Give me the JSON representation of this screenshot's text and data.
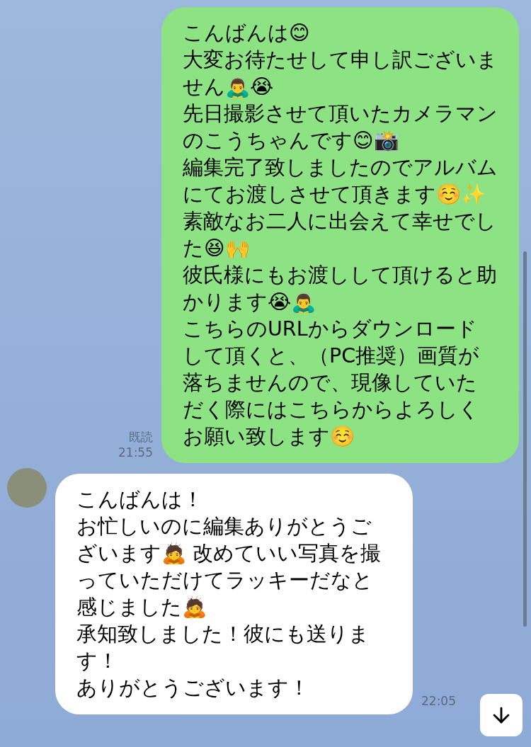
{
  "messages": [
    {
      "kind": "sent",
      "paragraphs": [
        "こんばんは😊",
        "大変お待たせして申し訳ございません🙇‍♂️😭",
        "先日撮影させて頂いたカメラマンのこうちゃんです😊📸",
        "編集完了致しましたのでアルバムにてお渡しさせて頂きます☺️✨",
        "素敵なお二人に出会えて幸せでした😆🙌",
        "彼氏様にもお渡しして頂けると助かります😭🙇‍♂️",
        "こちらのURLからダウンロードして頂くと、（PC推奨）画質が落ちませんので、現像していただく際にはこちらからよろしくお願い致します☺️"
      ],
      "read": "既読",
      "time": "21:55"
    },
    {
      "kind": "received",
      "paragraphs": [
        "こんばんは！",
        "お忙しいのに編集ありがとうございます🙇 改めていい写真を撮っていただけてラッキーだなと感じました🙇",
        "承知致しました！彼にも送ります！",
        "ありがとうございます！"
      ],
      "time": "22:05"
    }
  ]
}
